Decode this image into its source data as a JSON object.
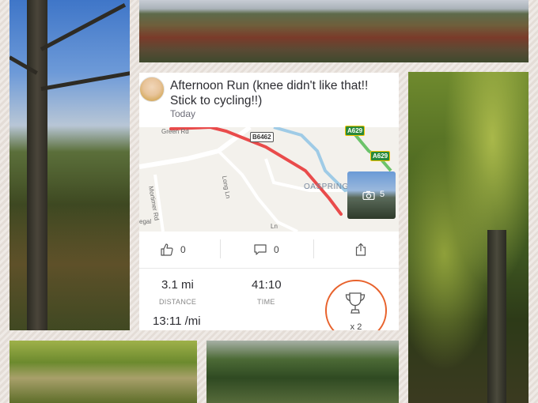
{
  "activity": {
    "title": "Afternoon Run (knee didn't like that!! Stick to cycling!!)",
    "date": "Today",
    "map": {
      "road_labels": [
        "Green Rd",
        "Long Ln",
        "Mortimer Rd",
        "Ln",
        "egal"
      ],
      "place_label": "OASPRING",
      "road_numbers": [
        "B6462",
        "A629",
        "A629"
      ],
      "photo_count": "5"
    },
    "actions": {
      "kudos_count": "0",
      "comments_count": "0"
    },
    "stats": {
      "distance_value": "3.1 mi",
      "distance_label": "DISTANCE",
      "time_value": "41:10",
      "time_label": "TIME",
      "pace_value": "13:11 /mi"
    },
    "achievements": {
      "count": "x 2"
    }
  },
  "colors": {
    "route": "#e94b4b",
    "accent": "#e8622c",
    "map_background": "#f3f1ec",
    "river": "#9fcbe6"
  },
  "icons": [
    "thumbs-up-icon",
    "comment-icon",
    "share-icon",
    "camera-icon",
    "trophy-icon"
  ]
}
